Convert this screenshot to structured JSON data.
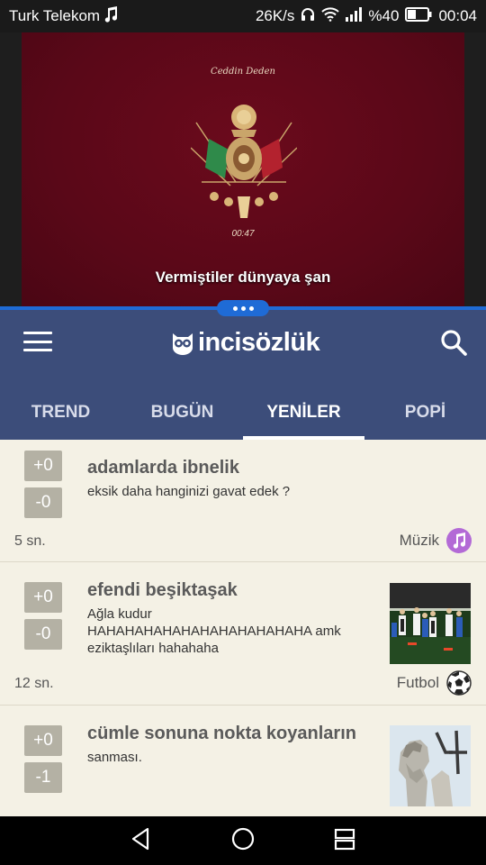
{
  "statusbar": {
    "carrier": "Turk Telekom",
    "speed": "26K/s",
    "battery": "%40",
    "time": "00:04"
  },
  "video": {
    "top_caption": "Ceddin Deden",
    "timestamp": "00:47",
    "subtitle": "Vermiştiler dünyaya şan"
  },
  "header": {
    "logo": "incisözlük",
    "tabs": [
      "TREND",
      "BUGÜN",
      "YENİLER",
      "POPİ"
    ],
    "active_tab": "YENİLER"
  },
  "posts": [
    {
      "up": "+0",
      "down": "-0",
      "title": "adamlarda ibnelik",
      "body": "eksik daha hanginizi gavat edek ?",
      "time": "5 sn.",
      "category": "Müzik",
      "category_icon": "music-note-icon",
      "category_color": "#b36ad6"
    },
    {
      "up": "+0",
      "down": "-0",
      "title": "efendi beşiktaşak",
      "body": "Ağla kudur HAHAHAHAHAHAHAHAHAHAHAHA amk eziktaşlıları hahahaha",
      "time": "12 sn.",
      "category": "Futbol",
      "category_icon": "soccer-ball-icon"
    },
    {
      "up": "+0",
      "down": "-1",
      "title": "cümle sonuna nokta koyanların",
      "body": "sanması."
    }
  ],
  "colors": {
    "appbar": "#3c4d7a",
    "accent": "#1f6bd6",
    "feed_bg": "#f4f1e5",
    "vote_bg": "#b4b1a4"
  }
}
